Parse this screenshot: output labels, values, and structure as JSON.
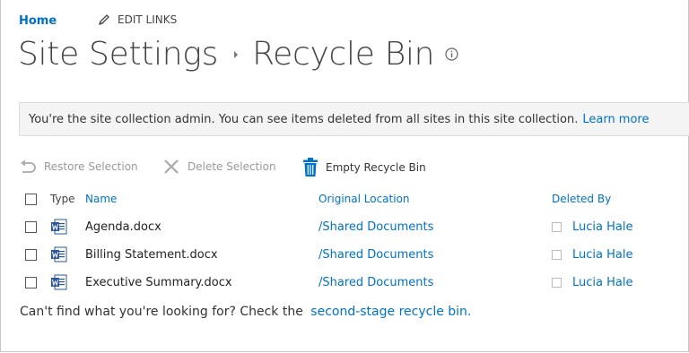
{
  "nav": {
    "home_label": "Home",
    "edit_links_label": "EDIT LINKS"
  },
  "page": {
    "title_parent": "Site Settings",
    "title_current": "Recycle Bin"
  },
  "notice": {
    "text": "You're the site collection admin. You can see items deleted from all sites in this site collection.",
    "link_label": "Learn more"
  },
  "toolbar": {
    "restore_label": "Restore Selection",
    "delete_label": "Delete Selection",
    "empty_label": "Empty Recycle Bin"
  },
  "table": {
    "headers": {
      "type": "Type",
      "name": "Name",
      "original_location": "Original Location",
      "deleted_by": "Deleted By"
    },
    "rows": [
      {
        "name": "Agenda.docx",
        "original_location": "/Shared Documents",
        "deleted_by": "Lucia Hale",
        "icon": "word-doc-icon"
      },
      {
        "name": "Billing Statement.docx",
        "original_location": "/Shared Documents",
        "deleted_by": "Lucia Hale",
        "icon": "word-doc-icon"
      },
      {
        "name": "Executive Summary.docx",
        "original_location": "/Shared Documents",
        "deleted_by": "Lucia Hale",
        "icon": "word-doc-icon"
      }
    ]
  },
  "footer": {
    "text": "Can't find what you're looking for? Check the",
    "link_label": "second-stage recycle bin."
  },
  "colors": {
    "link_blue": "#0072c6",
    "title_gray": "#444444",
    "disabled_gray": "#999999",
    "notice_bg": "#f4f4f4",
    "word_blue": "#2b579a"
  }
}
